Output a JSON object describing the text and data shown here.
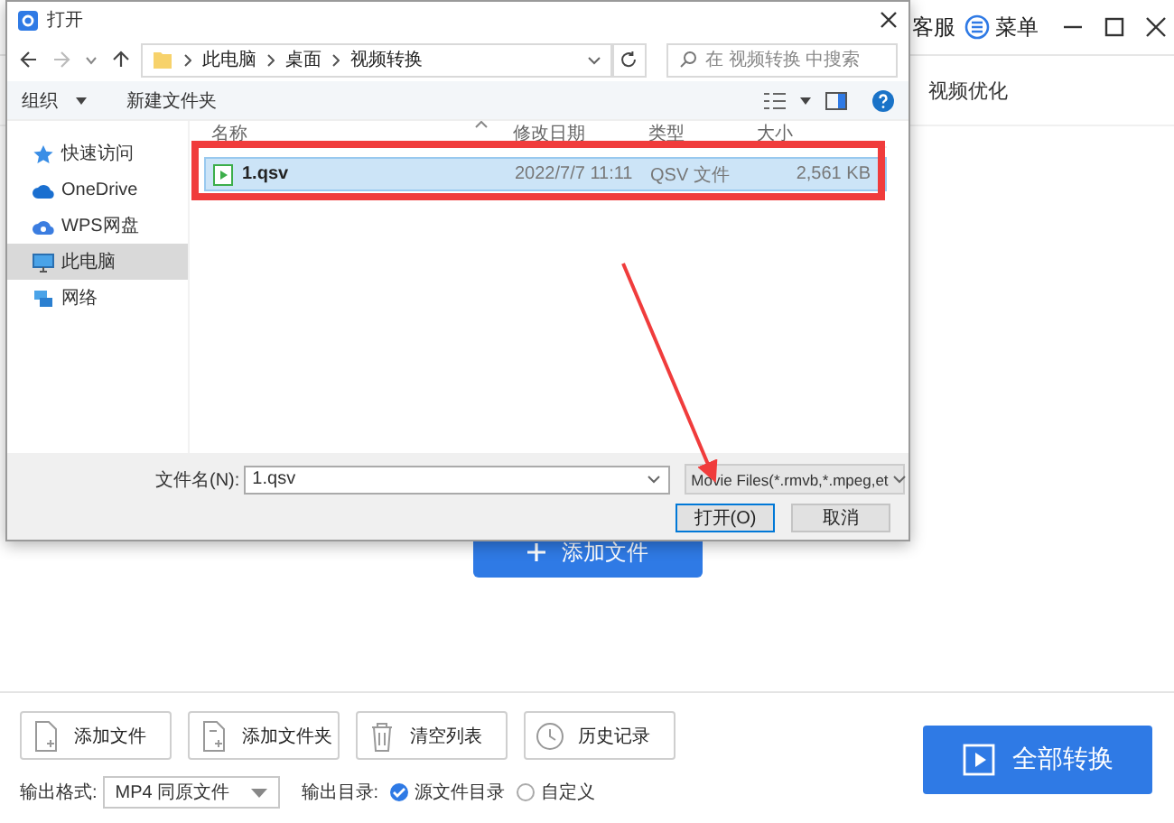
{
  "app": {
    "header": [
      {
        "kind": "text",
        "label": "客服"
      },
      {
        "kind": "menu",
        "label": "菜单"
      }
    ],
    "tabs": [
      {
        "label": "视频优化"
      }
    ],
    "add_file_button": {
      "label": "添加文件"
    },
    "actions": [
      {
        "kind": "file",
        "label": "添加文件"
      },
      {
        "kind": "folder",
        "label": "添加文件夹"
      },
      {
        "kind": "trash",
        "label": "清空列表"
      },
      {
        "kind": "clock",
        "label": "历史记录"
      }
    ],
    "output_format": {
      "label": "输出格式:",
      "value": "MP4 同原文件"
    },
    "output_dir": {
      "label": "输出目录:",
      "options": [
        {
          "label": "源文件目录",
          "selected": true
        },
        {
          "label": "自定义",
          "selected": false
        }
      ]
    },
    "convert_all": {
      "label": "全部转换"
    }
  },
  "dialog": {
    "title": "打开",
    "breadcrumb": [
      "此电脑",
      "桌面",
      "视频转换"
    ],
    "search_placeholder": "在 视频转换 中搜索",
    "toolbar": [
      {
        "label": "组织",
        "dropdown": true
      },
      {
        "label": "新建文件夹",
        "dropdown": false
      }
    ],
    "nav": [
      {
        "kind": "star",
        "label": "快速访问",
        "selected": false
      },
      {
        "kind": "cloud",
        "label": "OneDrive",
        "selected": false
      },
      {
        "kind": "wps",
        "label": "WPS网盘",
        "selected": false
      },
      {
        "kind": "pc",
        "label": "此电脑",
        "selected": true
      },
      {
        "kind": "network",
        "label": "网络",
        "selected": false
      }
    ],
    "columns": [
      "名称",
      "修改日期",
      "类型",
      "大小"
    ],
    "files": [
      {
        "name": "1.qsv",
        "modified": "2022/7/7 11:11",
        "type": "QSV 文件",
        "size": "2,561 KB",
        "selected": true
      }
    ],
    "filename": {
      "label": "文件名(N):",
      "value": "1.qsv"
    },
    "filter": "Movie Files(*.rmvb,*.mpeg,et",
    "buttons": [
      {
        "label": "打开(O)",
        "default": true
      },
      {
        "label": "取消",
        "default": false
      }
    ]
  }
}
